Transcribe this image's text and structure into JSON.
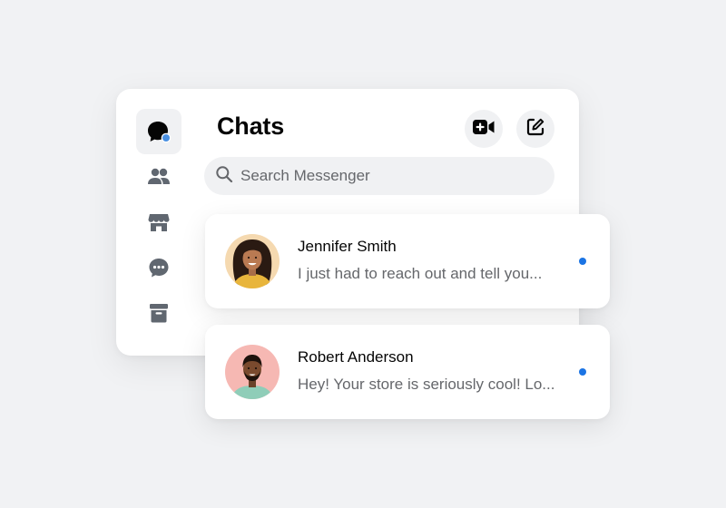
{
  "sidebar": {
    "items": [
      {
        "icon": "chat-bubble-icon",
        "active": true,
        "badge": true
      },
      {
        "icon": "people-icon",
        "active": false
      },
      {
        "icon": "marketplace-store-icon",
        "active": false
      },
      {
        "icon": "message-requests-icon",
        "active": false
      },
      {
        "icon": "archive-icon",
        "active": false
      }
    ]
  },
  "header": {
    "title": "Chats",
    "actions": [
      {
        "icon": "new-video-call-icon"
      },
      {
        "icon": "compose-icon"
      }
    ]
  },
  "search": {
    "placeholder": "Search Messenger"
  },
  "chats": [
    {
      "name": "Jennifer Smith",
      "preview": "I just had to reach out and tell you...",
      "unread": true,
      "avatar_bg": "#f5d9b0"
    },
    {
      "name": "Robert Anderson",
      "preview": "Hey! Your store is seriously cool! Lo...",
      "unread": true,
      "avatar_bg": "#f6b8b3"
    }
  ],
  "colors": {
    "accent": "#1b74e4",
    "badge": "#4a90e2",
    "background": "#f1f2f4",
    "icon": "#606770",
    "text_primary": "#050505",
    "text_secondary": "#65676b"
  }
}
